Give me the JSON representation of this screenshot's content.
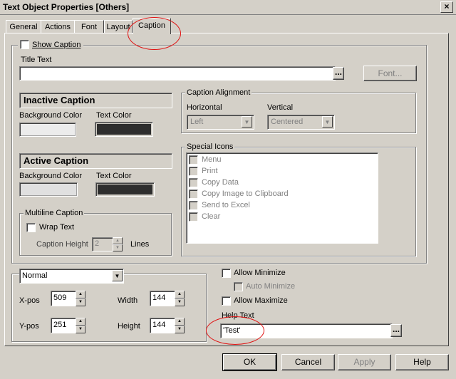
{
  "window": {
    "title": "Text Object Properties [Others]",
    "close_glyph": "×"
  },
  "tabs": [
    {
      "label": "General",
      "active": false
    },
    {
      "label": "Actions",
      "active": false
    },
    {
      "label": "Font",
      "active": false
    },
    {
      "label": "Layout",
      "active": false
    },
    {
      "label": "Caption",
      "active": true
    }
  ],
  "caption": {
    "show_caption_label": "Show Caption",
    "show_caption_checked": false,
    "title_text_label": "Title Text",
    "title_text_value": "",
    "title_text_dots": "...",
    "font_button": "Font...",
    "inactive": {
      "header": "Inactive Caption",
      "bg_label": "Background Color",
      "text_label": "Text Color"
    },
    "active": {
      "header": "Active Caption",
      "bg_label": "Background Color",
      "text_label": "Text Color"
    },
    "alignment": {
      "legend": "Caption Alignment",
      "horizontal_label": "Horizontal",
      "horizontal_value": "Left",
      "vertical_label": "Vertical",
      "vertical_value": "Centered"
    },
    "multiline": {
      "legend": "Multiline Caption",
      "wrap_label": "Wrap Text",
      "height_label": "Caption Height",
      "height_value": "2",
      "lines_label": "Lines"
    },
    "special_icons": {
      "legend": "Special Icons",
      "items": [
        "Menu",
        "Print",
        "Copy Data",
        "Copy Image to Clipboard",
        "Send to Excel",
        "Clear"
      ]
    },
    "position": {
      "state_value": "Normal",
      "xpos_label": "X-pos",
      "xpos_value": "509",
      "ypos_label": "Y-pos",
      "ypos_value": "251",
      "width_label": "Width",
      "width_value": "144",
      "height_label": "Height",
      "height_value": "144"
    },
    "allow_minimize_label": "Allow Minimize",
    "auto_minimize_label": "Auto Minimize",
    "allow_maximize_label": "Allow Maximize",
    "help_text_label": "Help Text",
    "help_text_value": "'Test'",
    "help_text_dots": "..."
  },
  "buttons": {
    "ok": "OK",
    "cancel": "Cancel",
    "apply": "Apply",
    "help": "Help"
  },
  "colors": {
    "dialog_bg": "#d4d0c8",
    "annotation_red": "#e01010",
    "inactive_bg_swatch": "#ececec",
    "active_bg_swatch": "#e0e0e0",
    "text_color_swatch": "#2e2e2e"
  },
  "icons": {
    "dropdown": "▼",
    "spin_up": "▲",
    "spin_down": "▼"
  }
}
